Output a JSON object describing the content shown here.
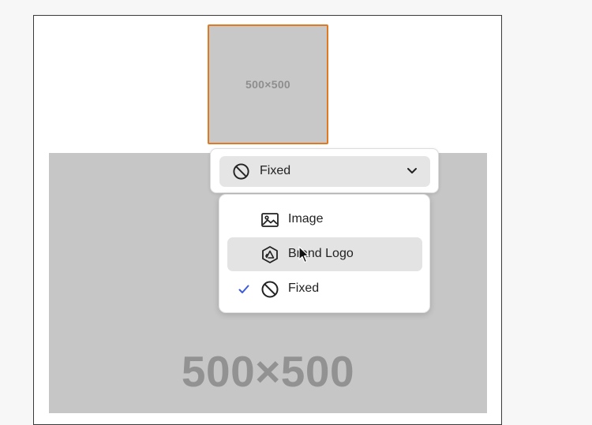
{
  "thumbnail": {
    "label": "500×500"
  },
  "canvas": {
    "label": "500×500"
  },
  "picker": {
    "value": "Fixed",
    "icon": "no-entry-icon"
  },
  "menu": {
    "items": [
      {
        "label": "Image",
        "icon": "image-icon",
        "selected": false,
        "hovered": false
      },
      {
        "label": "Brand Logo",
        "icon": "brand-logo-icon",
        "selected": false,
        "hovered": true
      },
      {
        "label": "Fixed",
        "icon": "no-entry-icon",
        "selected": true,
        "hovered": false
      }
    ]
  },
  "colors": {
    "accent_orange": "#e07a22",
    "check_blue": "#3b5bdb",
    "placeholder_gray": "#c6c6c6"
  }
}
